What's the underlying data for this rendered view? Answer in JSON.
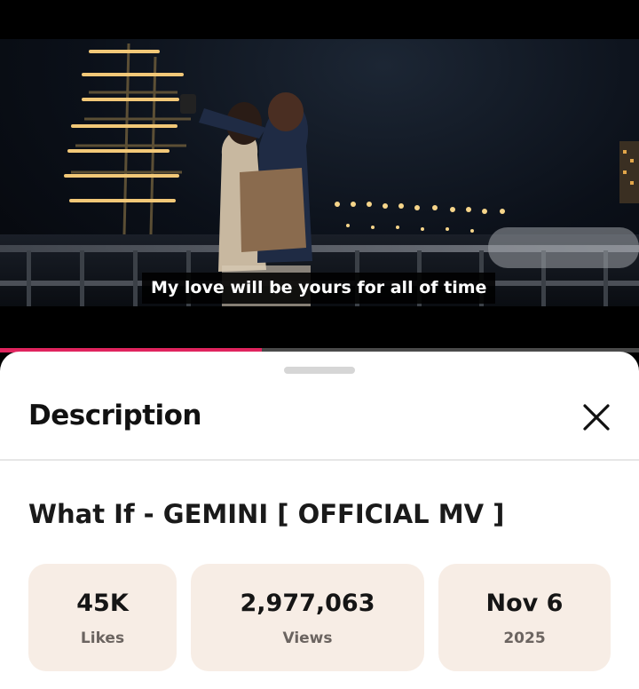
{
  "video": {
    "subtitle": "My love will be yours for all of time",
    "progress_fraction": 0.41
  },
  "sheet": {
    "title": "Description",
    "video_title": "What If - GEMINI [ OFFICIAL MV ]"
  },
  "stats": [
    {
      "value": "45K",
      "label": "Likes"
    },
    {
      "value": "2,977,063",
      "label": "Views"
    },
    {
      "value": "Nov 6",
      "label": "2025"
    }
  ],
  "colors": {
    "progress": "#e0245e",
    "stat_bg": "#f7ede5"
  },
  "icons": {
    "close": "close-icon",
    "drag_handle": "drag-handle"
  }
}
